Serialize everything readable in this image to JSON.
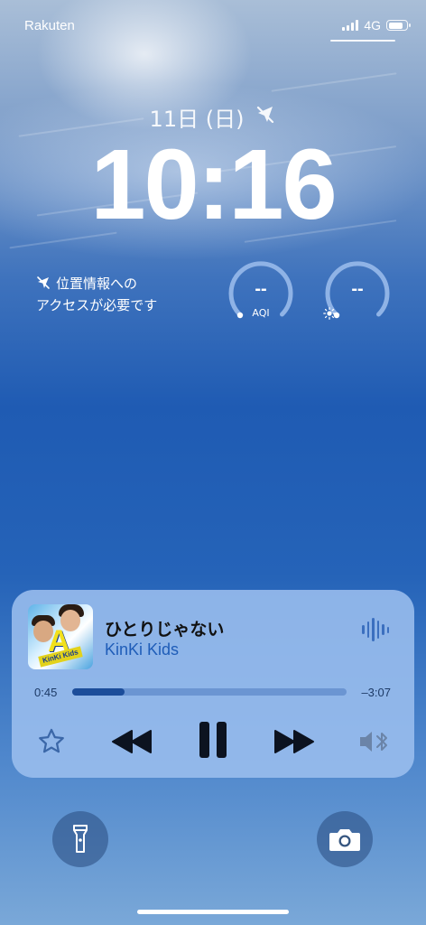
{
  "status_bar": {
    "carrier": "Rakuten",
    "network": "4G",
    "signal_bars": 4,
    "battery_level": 0.75
  },
  "lock": {
    "date": "11日 (日)",
    "time": "10:16",
    "date_icon": "no-location-icon"
  },
  "widgets": {
    "location_notice": {
      "icon": "location-slash-icon",
      "line1": "位置情報への",
      "line2": "アクセスが必要です"
    },
    "aqi": {
      "value": "--",
      "label": "AQI"
    },
    "uv": {
      "value": "--",
      "icon": "sun-icon"
    }
  },
  "now_playing": {
    "title": "ひとりじゃない",
    "artist": "KinKi Kids",
    "album_art": {
      "letter": "A",
      "band": "KinKi Kids"
    },
    "elapsed": "0:45",
    "remaining": "–3:07",
    "progress": 0.19,
    "accent_color": "#1f5db8",
    "controls": [
      "star-icon",
      "rewind-icon",
      "pause-icon",
      "fast-forward-icon",
      "bluetooth-speaker-icon"
    ]
  },
  "bottom": {
    "left": "flashlight-icon",
    "right": "camera-icon"
  }
}
